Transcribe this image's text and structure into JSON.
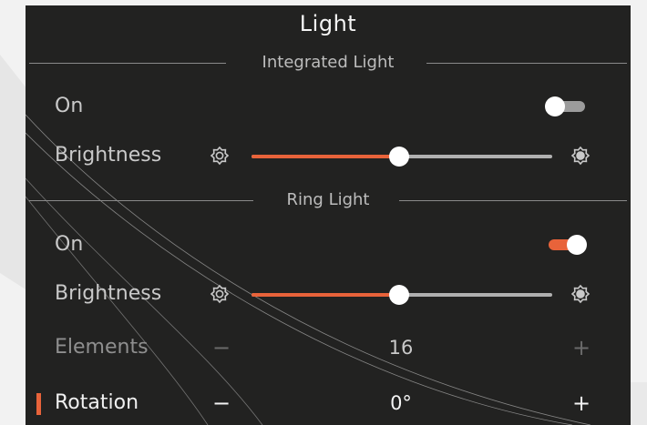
{
  "title": "Light",
  "colors": {
    "accent": "#e8633a",
    "panel": "#222221",
    "text": "#c9c9c9",
    "off_track": "#9c9c9c"
  },
  "integrated": {
    "header": "Integrated Light",
    "on_label": "On",
    "on_state": false,
    "brightness_label": "Brightness",
    "brightness_value": 0.49,
    "icon_low": "brightness-low-icon",
    "icon_high": "brightness-high-icon"
  },
  "ring": {
    "header": "Ring Light",
    "on_label": "On",
    "on_state": true,
    "brightness_label": "Brightness",
    "brightness_value": 0.49,
    "elements_label": "Elements",
    "elements_value": "16",
    "rotation_label": "Rotation",
    "rotation_value": "0°",
    "minus": "−",
    "plus": "+"
  }
}
